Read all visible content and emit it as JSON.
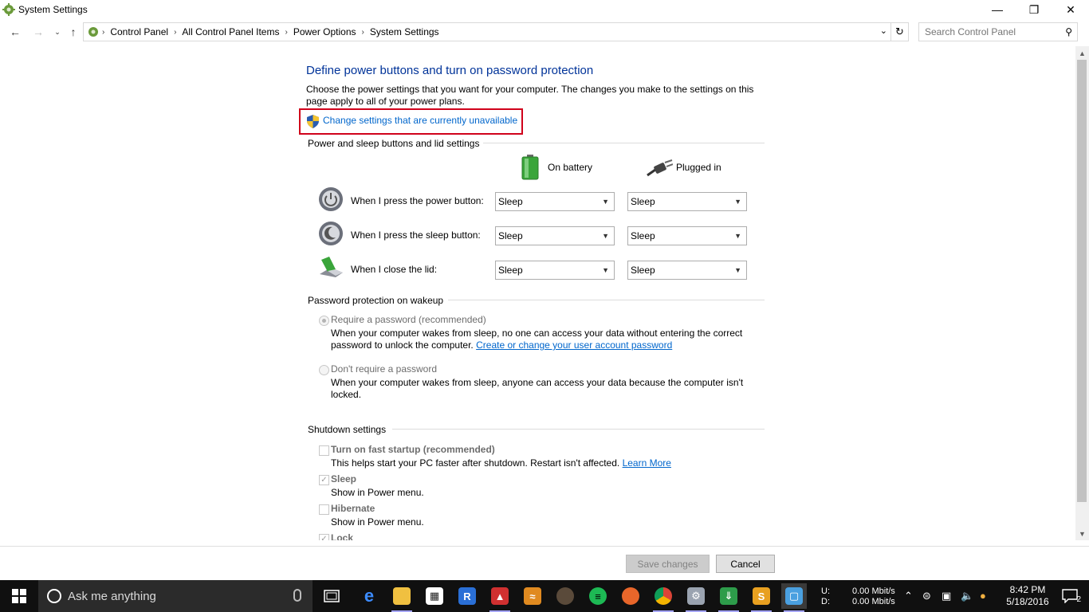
{
  "window": {
    "title": "System Settings",
    "minimize": "—",
    "maximize": "❐",
    "close": "✕"
  },
  "address": {
    "breadcrumbs": [
      "Control Panel",
      "All Control Panel Items",
      "Power Options",
      "System Settings"
    ],
    "search_placeholder": "Search Control Panel"
  },
  "page": {
    "heading": "Define power buttons and turn on password protection",
    "description": "Choose the power settings that you want for your computer. The changes you make to the settings on this page apply to all of your power plans.",
    "change_link": "Change settings that are currently unavailable",
    "power_section": {
      "title": "Power and sleep buttons and lid settings",
      "col_battery": "On battery",
      "col_plugged": "Plugged in",
      "rows": [
        {
          "label": "When I press the power button:",
          "battery": "Sleep",
          "plugged": "Sleep"
        },
        {
          "label": "When I press the sleep button:",
          "battery": "Sleep",
          "plugged": "Sleep"
        },
        {
          "label": "When I close the lid:",
          "battery": "Sleep",
          "plugged": "Sleep"
        }
      ]
    },
    "password_section": {
      "title": "Password protection on wakeup",
      "require_label": "Require a password (recommended)",
      "require_desc_1": "When your computer wakes from sleep, no one can access your data without entering the correct",
      "require_desc_2": "password to unlock the computer.",
      "require_link": "Create or change your user account password",
      "norequire_label": "Don't require a password",
      "norequire_desc_1": "When your computer wakes from sleep, anyone can access your data because the computer isn't",
      "norequire_desc_2": "locked."
    },
    "shutdown_section": {
      "title": "Shutdown settings",
      "fast_startup_label": "Turn on fast startup (recommended)",
      "fast_startup_desc": "This helps start your PC faster after shutdown. Restart isn't affected.",
      "learn_more": "Learn More",
      "sleep_label": "Sleep",
      "sleep_desc": "Show in Power menu.",
      "hibernate_label": "Hibernate",
      "hibernate_desc": "Show in Power menu.",
      "lock_label": "Lock"
    }
  },
  "buttons": {
    "save": "Save changes",
    "cancel": "Cancel"
  },
  "taskbar": {
    "search_placeholder": "Ask me anything",
    "network_labels": "U:\nD:",
    "upload_rate": "0.00 Mbit/s",
    "download_rate": "0.00 Mbit/s",
    "time": "8:42 PM",
    "date": "5/18/2016",
    "notifications": "2"
  },
  "colors": {
    "heading": "#003399",
    "link": "#0066cc",
    "highlight_box": "#d0021b",
    "taskbar": "#101010"
  }
}
